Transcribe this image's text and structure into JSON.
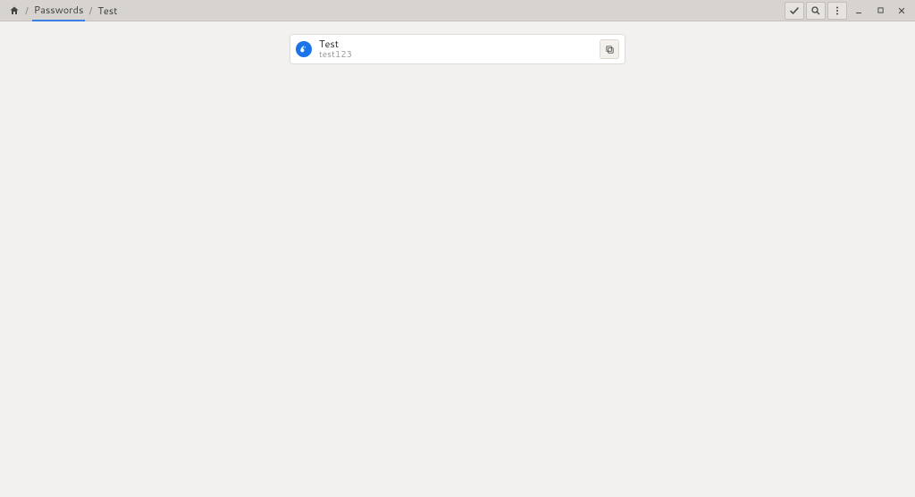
{
  "breadcrumb": {
    "root_label": "Passwords",
    "current_label": "Test"
  },
  "entry": {
    "title": "Test",
    "subtitle": "test123"
  },
  "icons": {
    "home": "home-icon",
    "select": "check-icon",
    "search": "search-icon",
    "menu": "kebab-icon",
    "minimize": "minimize-icon",
    "maximize": "maximize-icon",
    "close": "close-icon",
    "key": "key-icon",
    "copy": "copy-icon"
  }
}
